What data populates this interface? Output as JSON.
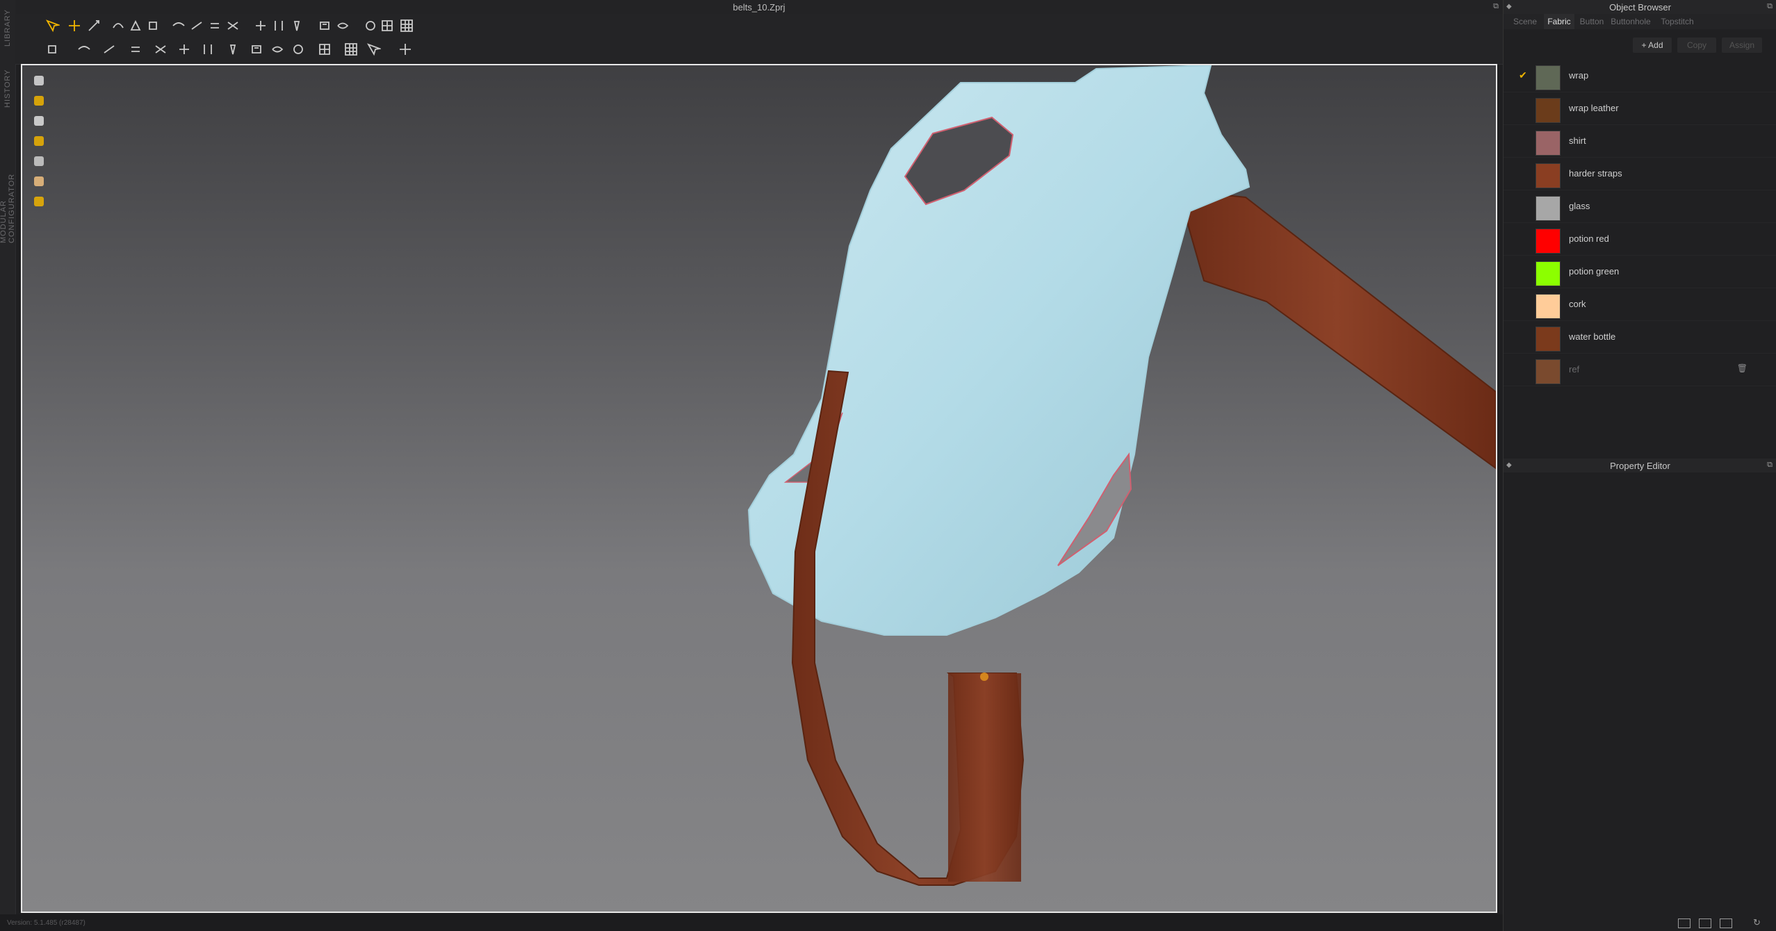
{
  "window": {
    "title": "belts_10.Zprj"
  },
  "left_strip": {
    "tabs": [
      "LIBRARY",
      "HISTORY",
      "MODULAR CONFIGURATOR"
    ]
  },
  "status": {
    "version": "Version: 5.1.485 (r28487)"
  },
  "object_browser": {
    "title": "Object Browser",
    "tabs": [
      "Scene",
      "Fabric",
      "Button",
      "Buttonhole",
      "Topstitch"
    ],
    "active_tab": "Fabric",
    "actions": {
      "add": "+ Add",
      "copy": "Copy",
      "assign": "Assign"
    },
    "fabrics": [
      {
        "name": "wrap",
        "color": "#5f6856",
        "checked": true
      },
      {
        "name": "wrap leather",
        "color": "#6b3c1b",
        "checked": false
      },
      {
        "name": "shirt",
        "color": "#9a6466",
        "checked": false
      },
      {
        "name": "harder straps",
        "color": "#8a3e22",
        "checked": false
      },
      {
        "name": "glass",
        "color": "#a7a7a7",
        "checked": false
      },
      {
        "name": "potion red",
        "color": "#ff0000",
        "checked": false
      },
      {
        "name": "potion green",
        "color": "#8cff00",
        "checked": false
      },
      {
        "name": "cork",
        "color": "#ffcc99",
        "checked": false
      },
      {
        "name": "water bottle",
        "color": "#7b3a1c",
        "checked": false
      },
      {
        "name": "ref",
        "color": "#7a4a2e",
        "checked": false,
        "dim": true
      }
    ]
  },
  "property_editor": {
    "title": "Property Editor"
  },
  "colors": {
    "accent": "#f0b400",
    "cloth": "#b7dde8",
    "strap": "#8a3e22"
  },
  "icons": {
    "toolbar_row1": [
      "select-move-icon",
      "transform-icon",
      "edit-pattern-icon",
      "edit-curvature-icon",
      "edit-point-icon",
      "add-point-icon",
      "sew-icon",
      "free-sew-icon",
      "segment-sew-icon",
      "m-n-sew-icon",
      "fold-icon",
      "tack-icon",
      "pin-icon",
      "strengthen-icon",
      "shrinkage-icon",
      "lasso-icon",
      "mesh-icon",
      "grid-icon"
    ],
    "toolbar_row2": [
      "avatar-pose-icon",
      "simulate-icon",
      "fitting-icon",
      "skin-icon",
      "flatten-icon",
      "unfold-icon",
      "texture-icon",
      "pattern-icon",
      "button-icon",
      "buttonhole-icon",
      "zipper-icon",
      "piping-icon",
      "elastic-icon",
      "measure-icon",
      "gizmo-icon"
    ],
    "viewport_tools": [
      "garment-icon",
      "fabric-icon",
      "avatar-icon",
      "layer-icon",
      "eraser-icon",
      "avatar-head-icon",
      "globe-icon"
    ]
  }
}
